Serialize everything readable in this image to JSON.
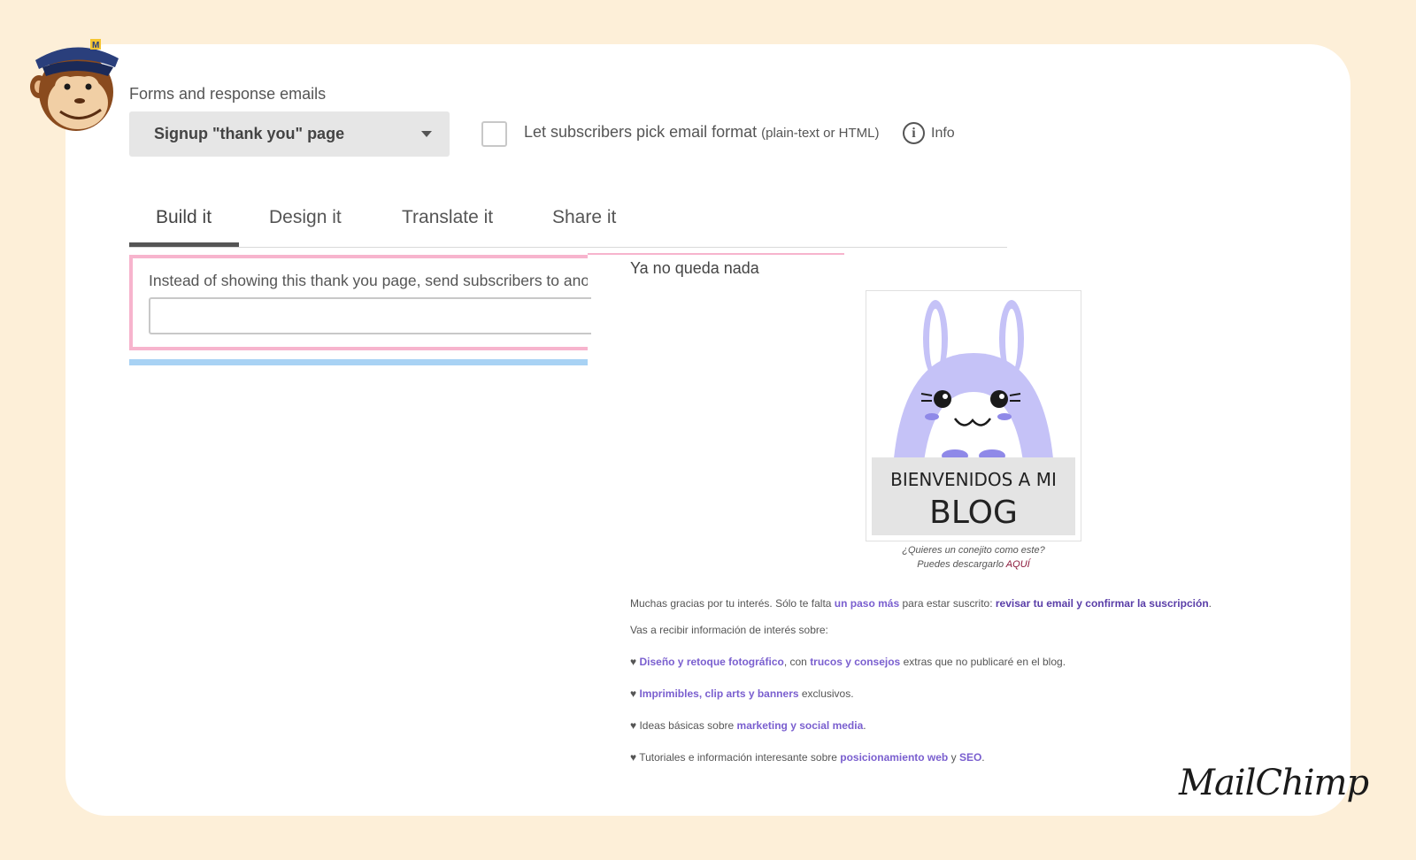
{
  "header": {
    "section_title": "Forms and response emails"
  },
  "form_select": {
    "selected": "Signup \"thank you\" page"
  },
  "format_option": {
    "label": "Let subscribers pick email format",
    "hint": "(plain-text or HTML)",
    "info_label": "Info"
  },
  "tabs": [
    {
      "label": "Build it"
    },
    {
      "label": "Design it"
    },
    {
      "label": "Translate it"
    },
    {
      "label": "Share it"
    }
  ],
  "redirect": {
    "text": "Instead of showing this thank you page, send subscribers to another URL",
    "input_value": ""
  },
  "preview": {
    "title": "Ya no queda nada",
    "image_text_line1": "BIENVENIDOS A MI",
    "image_text_line2": "BLOG",
    "caption_line1": "¿Quieres un conejito como este?",
    "caption_line2_prefix": "Puedes descargarlo",
    "caption_line2_link": "AQUÍ",
    "p1": {
      "a": "Muchas gracias por tu interés. Sólo te falta ",
      "b": "un paso más",
      "c": " para estar suscrito: ",
      "d": "revisar tu email y confirmar la suscripción",
      "e": "."
    },
    "p2": "Vas a recibir información de interés sobre:",
    "b1": {
      "a": "♥ ",
      "b": "Diseño y retoque fotográfico",
      "c": ", con ",
      "d": "trucos y consejos",
      "e": " extras que no publicaré en el blog."
    },
    "b2": {
      "a": "♥ ",
      "b": "Imprimibles, clip arts y banners",
      "c": " exclusivos."
    },
    "b3": {
      "a": "♥ Ideas básicas sobre ",
      "b": "marketing y social media",
      "c": "."
    },
    "b4": {
      "a": "♥ Tutoriales e información interesante sobre ",
      "b": "posicionamiento web",
      "c": " y ",
      "d": "SEO",
      "e": "."
    }
  },
  "brand": {
    "logo_text": "MailChimp"
  },
  "colors": {
    "page_bg": "#fdefd8",
    "accent_pink": "#f7b4cd",
    "accent_blue": "#a8d2f4",
    "link_purple": "#7a5fcf",
    "bunny_purple": "#c5c2f7"
  }
}
